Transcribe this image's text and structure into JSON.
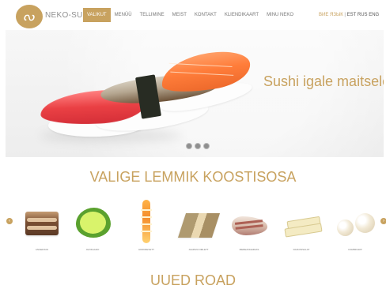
{
  "brand": {
    "name": "NEKO-SUS",
    "logo_icon": "logo-icon"
  },
  "nav": {
    "items": [
      {
        "label": "VALIKUT",
        "active": true
      },
      {
        "label": "MENÜÜ",
        "active": false
      },
      {
        "label": "TELLIMINE",
        "active": false
      },
      {
        "label": "MEIST",
        "active": false
      },
      {
        "label": "KONTAKT",
        "active": false
      },
      {
        "label": "KLIENDIKAART",
        "active": false
      },
      {
        "label": "MINU NEKO",
        "active": false
      }
    ],
    "language": {
      "option": "ВИЕ ЯЗЫК",
      "separator": "|",
      "current": "EST RUS ENG"
    }
  },
  "hero": {
    "tagline": "Sushi igale maitsele",
    "slides": 3
  },
  "sections": {
    "favorites_title": "VALIGE LEMMIK KOOSTISOSA",
    "new_title": "UUED ROAD"
  },
  "ingredients": [
    {
      "label": "ANGERJAS",
      "icon": "eel-icon"
    },
    {
      "label": "AVOKAADO",
      "icon": "avocado-icon"
    },
    {
      "label": "HIIDKREVETT",
      "icon": "shrimp-icon"
    },
    {
      "label": "JAAPANI OMLETT",
      "icon": "omelet-icon"
    },
    {
      "label": "MEREANGERJAS",
      "icon": "sea-eel-icon"
    },
    {
      "label": "DAIKONSALAT",
      "icon": "radish-icon"
    },
    {
      "label": "KAMMKARP",
      "icon": "scallop-icon"
    }
  ],
  "colors": {
    "accent": "#c8a25f"
  }
}
